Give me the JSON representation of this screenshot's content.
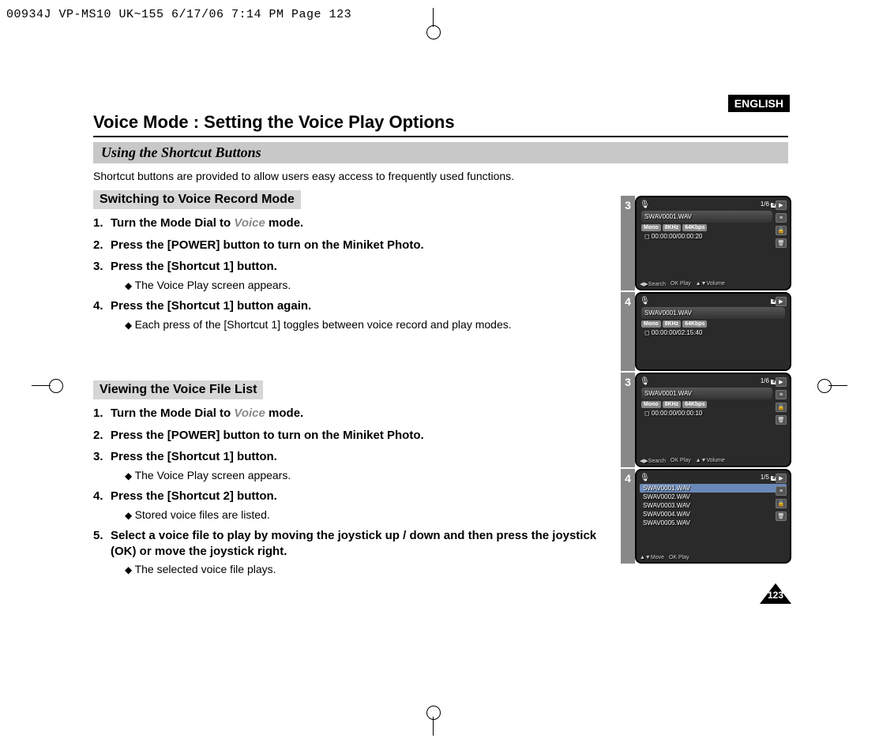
{
  "crop_header": "00934J VP-MS10 UK~155  6/17/06 7:14 PM  Page 123",
  "lang": "ENGLISH",
  "title": "Voice Mode : Setting the Voice Play Options",
  "subtitle": "Using the Shortcut Buttons",
  "intro": "Shortcut buttons are provided to allow users easy access to frequently used functions.",
  "section_a": "Switching to Voice Record Mode",
  "steps_a": {
    "s1a": "Turn the Mode Dial to ",
    "s1b": "Voice",
    "s1c": " mode.",
    "s2": "Press the [POWER] button to turn on the Miniket Photo.",
    "s3": "Press the [Shortcut 1] button.",
    "s3sub": "The Voice Play screen appears.",
    "s4": "Press the [Shortcut 1] button again.",
    "s4sub": "Each press of the [Shortcut 1] toggles between voice record and play modes."
  },
  "section_b": "Viewing the Voice File List",
  "steps_b": {
    "s1a": "Turn the Mode Dial to ",
    "s1b": "Voice",
    "s1c": " mode.",
    "s2": "Press the [POWER] button to turn on the Miniket Photo.",
    "s3": "Press the [Shortcut 1] button.",
    "s3sub": "The Voice Play screen appears.",
    "s4": "Press the [Shortcut 2] button.",
    "s4sub": "Stored voice files are listed.",
    "s5": "Select a voice file to play by moving the joystick up / down and then press the joystick (OK) or move the joystick right.",
    "s5sub": "The selected voice file plays."
  },
  "screens": {
    "r1": {
      "num": "3",
      "counter": "1/6",
      "in": "IN",
      "file": "SWAV0001.WAV",
      "tag1": "Mono",
      "tag2": "8KHz",
      "tag3": "64Kbps",
      "time": "00:00:00/00:00:20",
      "b1": "Search",
      "b2": "OK Play",
      "b3": "Volume"
    },
    "r2": {
      "num": "4",
      "in": "IN",
      "file": "SWAV0001.WAV",
      "tag1": "Mono",
      "tag2": "8KHz",
      "tag3": "64Kbps",
      "time": "00:00:00/02:15:40"
    },
    "r3": {
      "num": "3",
      "counter": "1/6",
      "in": "IN",
      "file": "SWAV0001.WAV",
      "tag1": "Mono",
      "tag2": "8KHz",
      "tag3": "64Kbps",
      "time": "00:00:00/00:00:10",
      "b1": "Search",
      "b2": "OK Play",
      "b3": "Volume"
    },
    "r4": {
      "num": "4",
      "counter": "1/5",
      "in": "IN",
      "files": {
        "f1": "SWAV0001.WAV",
        "f2": "SWAV0002.WAV",
        "f3": "SWAV0003.WAV",
        "f4": "SWAV0004.WAV",
        "f5": "SWAV0005.WAV"
      },
      "b1": "Move",
      "b2": "OK Play"
    }
  },
  "pagenum": "123"
}
